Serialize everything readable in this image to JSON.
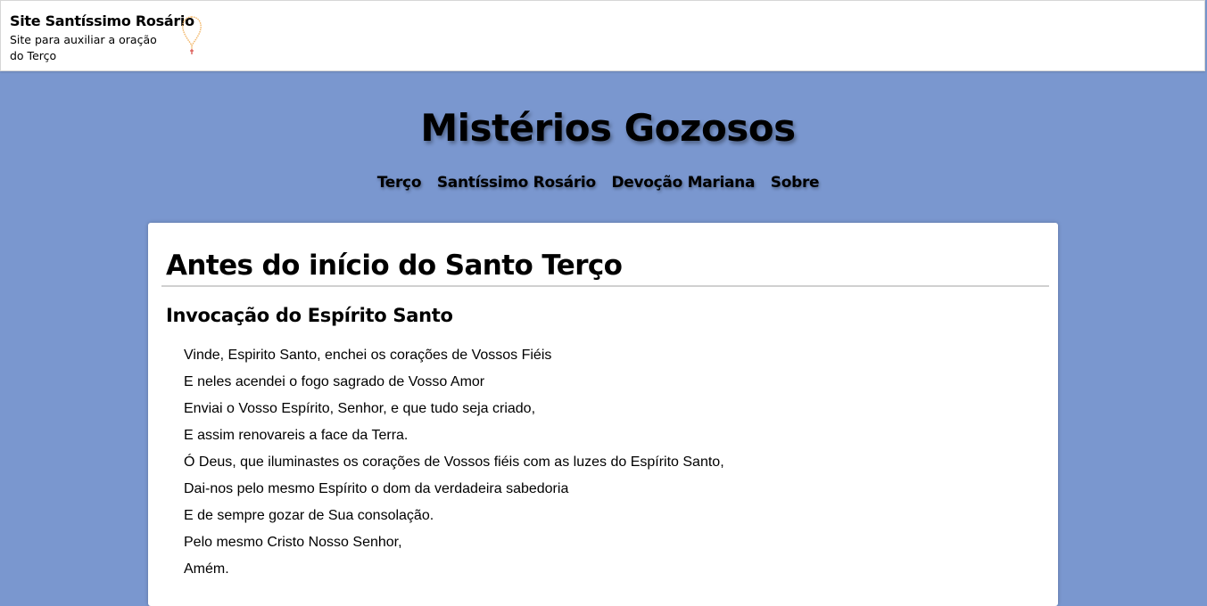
{
  "site": {
    "title": "Site Santíssimo Rosário",
    "subtitle": "Site para auxiliar a oração do Terço",
    "logo_icon": "rosary-icon",
    "logo_color": "#f2b76a",
    "cross_color": "#d9534f"
  },
  "page": {
    "title": "Mistérios Gozosos",
    "background_color": "#7a97cf"
  },
  "nav": {
    "items": [
      {
        "label": "Terço"
      },
      {
        "label": "Santíssimo Rosário"
      },
      {
        "label": "Devoção Mariana"
      },
      {
        "label": "Sobre"
      }
    ]
  },
  "content": {
    "section_title": "Antes do início do Santo Terço",
    "prayer_title": "Invocação do Espírito Santo",
    "prayer_lines": [
      "Vinde, Espirito Santo, enchei os corações de Vossos Fiéis",
      "E neles acendei o fogo sagrado de Vosso Amor",
      "Enviai o Vosso Espírito, Senhor, e que tudo seja criado,",
      "E assim renovareis a face da Terra.",
      "Ó Deus, que iluminastes os corações de Vossos fiéis com as luzes do Espírito Santo,",
      "Dai-nos pelo mesmo Espírito o dom da verdadeira sabedoria",
      "E de sempre gozar de Sua consolação.",
      "Pelo mesmo Cristo Nosso Senhor,",
      "Amém."
    ]
  }
}
